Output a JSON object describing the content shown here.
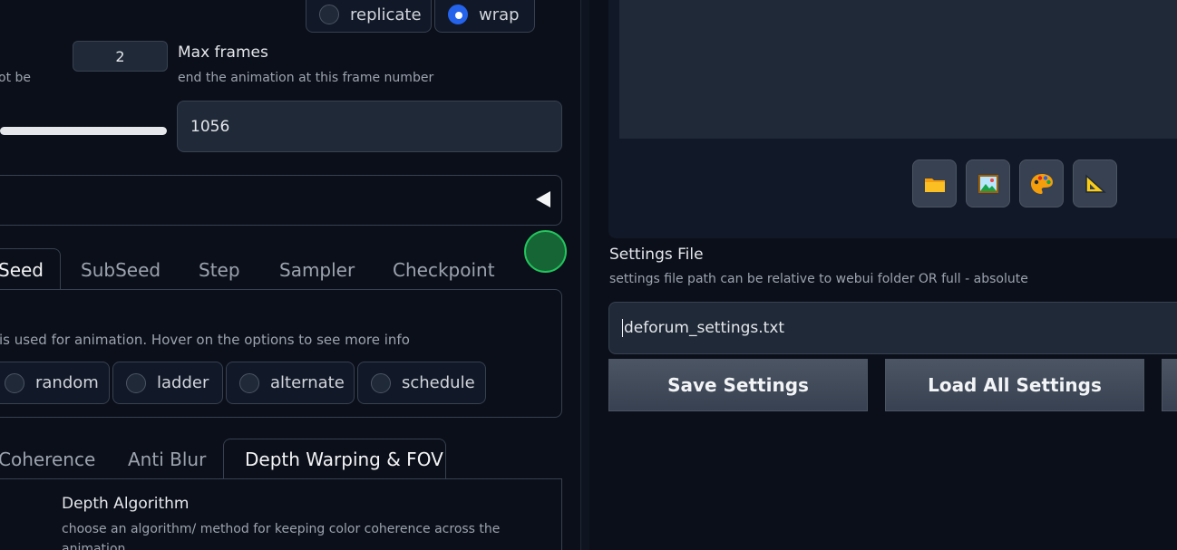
{
  "border_mode": {
    "options": [
      "replicate",
      "wrap"
    ],
    "selected": "wrap"
  },
  "seed_steps": {
    "value": "2",
    "desc_fragment": "ot be"
  },
  "max_frames": {
    "label": "Max frames",
    "description": "end the animation at this frame number",
    "value": "1056"
  },
  "seed_tabs": [
    "Seed",
    "SubSeed",
    "Step",
    "Sampler",
    "Checkpoint"
  ],
  "seed_tabs_active": "Seed",
  "seed_behavior": {
    "description": "is used for animation. Hover on the options to see more info",
    "options": [
      "random",
      "ladder",
      "alternate",
      "schedule"
    ]
  },
  "warp_tabs": [
    "Coherence",
    "Anti Blur",
    "Depth Warping & FOV"
  ],
  "warp_tabs_active": "Depth Warping & FOV",
  "depth": {
    "label": "Depth Algorithm",
    "description": "choose an algorithm/ method for keeping color coherence across the",
    "description_line2": "animation"
  },
  "settings_file": {
    "label": "Settings File",
    "description": "settings file path can be relative to webui folder OR full - absolute",
    "value": "deforum_settings.txt"
  },
  "buttons": {
    "save": "Save Settings",
    "load": "Load All Settings"
  },
  "gallery_icons": [
    "folder-icon",
    "image-icon",
    "palette-icon",
    "ruler-icon"
  ],
  "colors": {
    "accent": "#2563eb",
    "status": "#166534"
  }
}
